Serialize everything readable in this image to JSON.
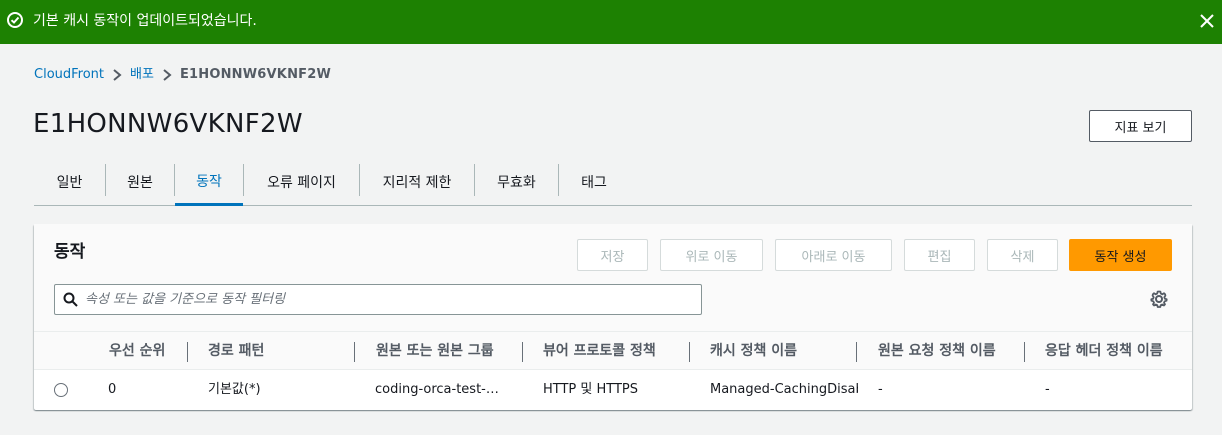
{
  "flash": {
    "message": "기본 캐시 동작이 업데이트되었습니다.",
    "color": "#1d8102"
  },
  "breadcrumb": [
    {
      "label": "CloudFront"
    },
    {
      "label": "배포"
    },
    {
      "label": "E1HONNW6VKNF2W"
    }
  ],
  "page": {
    "title": "E1HONNW6VKNF2W",
    "metrics_button": "지표 보기"
  },
  "tabs": [
    {
      "label": "일반"
    },
    {
      "label": "원본"
    },
    {
      "label": "동작"
    },
    {
      "label": "오류 페이지"
    },
    {
      "label": "지리적 제한"
    },
    {
      "label": "무효화"
    },
    {
      "label": "태그"
    }
  ],
  "active_tab": "동작",
  "behaviors": {
    "title": "동작",
    "buttons": {
      "save": "저장",
      "move_up": "위로 이동",
      "move_down": "아래로 이동",
      "edit": "편집",
      "delete": "삭제",
      "create": "동작 생성"
    },
    "filter_placeholder": "속성 또는 값을 기준으로 동작 필터링",
    "columns": [
      "우선 순위",
      "경로 패턴",
      "원본 또는 원본 그룹",
      "뷰어 프로토콜 정책",
      "캐시 정책 이름",
      "원본 요청 정책 이름",
      "응답 헤더 정책 이름"
    ],
    "rows": [
      [
        "0",
        "기본값(*)",
        "coding-orca-test-…",
        "HTTP 및 HTTPS",
        "Managed-CachingDisab",
        "-",
        "-"
      ]
    ]
  },
  "colors": {
    "accent": "#0073bb",
    "primary_button": "#ff9900",
    "success": "#1d8102"
  }
}
